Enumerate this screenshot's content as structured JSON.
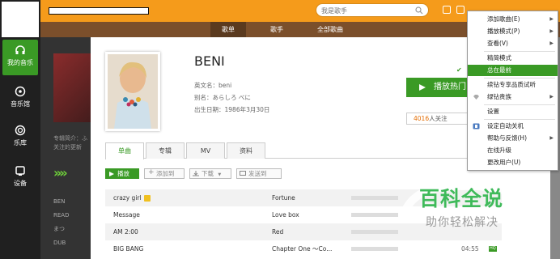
{
  "colors": {
    "accent": "#3a9a25",
    "topbar": "#f59b1b",
    "navbar": "#7b4f2b",
    "sidebar": "#202020"
  },
  "search": {
    "placeholder": "我是歌手"
  },
  "sidebar": {
    "items": [
      {
        "label": "我的音乐",
        "icon": "headphones-icon"
      },
      {
        "label": "音乐馆",
        "icon": "music-hall-icon"
      },
      {
        "label": "乐库",
        "icon": "disc-icon"
      },
      {
        "label": "设备",
        "icon": "device-icon"
      }
    ]
  },
  "nav": {
    "items": [
      "歌单",
      "歌手",
      "全部歌曲"
    ]
  },
  "artist": {
    "name": "BENI",
    "english_name": "英文名：beni",
    "alias": "别名：あらしろ べに",
    "birthday": "出生日期：1986年3月30日",
    "play_hot": "播放热门",
    "follow_count": "4016",
    "follow_suffix": "人关注"
  },
  "tabs": [
    "单曲",
    "专辑",
    "MV",
    "资料"
  ],
  "actions": {
    "play": "播放",
    "add": "添加到",
    "download": "下载",
    "send": "发送到"
  },
  "songs": [
    {
      "title": "crazy girl",
      "album": "Fortune",
      "duration": "",
      "vip": true
    },
    {
      "title": "Message",
      "album": "Love box",
      "duration": ""
    },
    {
      "title": "AM 2:00",
      "album": "Red",
      "duration": ""
    },
    {
      "title": "BIG BANG",
      "album": "Chapter One ～Co...",
      "duration": "04:55",
      "hq": "HQ"
    }
  ],
  "dimmed": {
    "line1": "专辑简介：ふ",
    "line2": "关注的更新",
    "rows": [
      "BEN",
      "READ",
      "まつ",
      "DUB"
    ]
  },
  "context_menu": {
    "items": [
      {
        "label": "添加歌曲(E)",
        "submenu": true
      },
      {
        "label": "播放模式(P)",
        "submenu": true
      },
      {
        "label": "查看(V)",
        "submenu": true
      },
      {
        "label": "精简模式"
      },
      {
        "label": "总在最前",
        "checked": true,
        "highlighted": true
      },
      {
        "label": "续钻专享品质试听"
      },
      {
        "label": "绿钻贵族",
        "submenu": true
      },
      {
        "label": "设置"
      },
      {
        "label": "设定自动关机"
      },
      {
        "label": "帮助与反馈(H)",
        "submenu": true
      },
      {
        "label": "在线升级"
      },
      {
        "label": "更改用户(U)"
      }
    ]
  },
  "watermark": {
    "title": "百科全说",
    "subtitle": "助你轻松解决"
  }
}
